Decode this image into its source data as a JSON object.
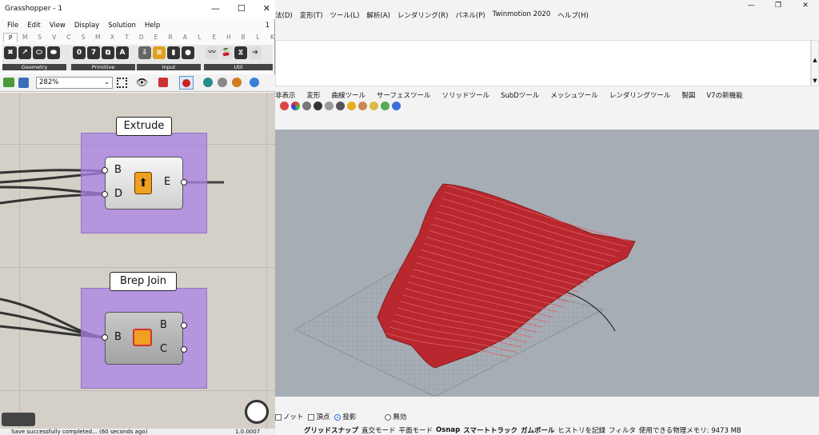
{
  "rhino": {
    "menu": [
      "法(D)",
      "変形(T)",
      "ツール(L)",
      "解析(A)",
      "レンダリング(R)",
      "パネル(P)",
      "Twinmotion 2020",
      "ヘルプ(H)"
    ],
    "window_controls": [
      "—",
      "❐",
      "✕"
    ],
    "scroll_up": "▲",
    "scroll_down": "▼",
    "tabs": [
      "非表示",
      "変形",
      "曲線ツール",
      "サーフェスツール",
      "ソリッドツール",
      "SubDツール",
      "メッシュツール",
      "レンダリングツール",
      "製図",
      "V7の新機能"
    ],
    "osnap": {
      "knot": "ノット",
      "vertex": "頂点",
      "project": "投影",
      "disable": "無効"
    },
    "status": {
      "grid_snap": "グリッドスナップ",
      "ortho": "直交モード",
      "planar": "平面モード",
      "osnap": "Osnap",
      "smarttrack": "スマートトラック",
      "gumball": "ガムボール",
      "history": "ヒストリを記録",
      "filter": "フィルタ",
      "memory": "使用できる物理メモリ: 9473 MB"
    },
    "colors": {
      "surface": "#b8282e",
      "viewport": "#a7adb4"
    }
  },
  "gh": {
    "title": "Grasshopper - 1",
    "window_controls": [
      "—",
      "☐",
      "✕"
    ],
    "menu": [
      "File",
      "Edit",
      "View",
      "Display",
      "Solution",
      "Help"
    ],
    "page_indicator": "1",
    "tabs": [
      "P",
      "M",
      "S",
      "V",
      "C",
      "S",
      "M",
      "X",
      "T",
      "D",
      "E",
      "R",
      "A",
      "L",
      "E",
      "H",
      "B",
      "L",
      "K"
    ],
    "ribbon_groups": [
      {
        "label": "Geometry",
        "icons": [
          "✖",
          "↗",
          "⬭",
          "⬬"
        ]
      },
      {
        "label": "Primitive",
        "icons": [
          "0",
          "7",
          "⧉",
          "A"
        ]
      },
      {
        "label": "Input",
        "icons": [
          "⇩",
          "≋",
          "▮",
          "●"
        ]
      },
      {
        "label": "Util",
        "icons": [
          "〰",
          "🍒",
          "⧖",
          "➔"
        ]
      }
    ],
    "zoom": "282%",
    "canvas": {
      "extrude": {
        "title": "Extrude",
        "inputs": [
          "B",
          "D"
        ],
        "outputs": [
          "E"
        ]
      },
      "brepjoin": {
        "title": "Brep Join",
        "inputs": [
          "B"
        ],
        "outputs": [
          "B",
          "C"
        ]
      }
    },
    "status_text": "Save successfully completed... (60 seconds ago)",
    "version": "1.0.0007"
  }
}
